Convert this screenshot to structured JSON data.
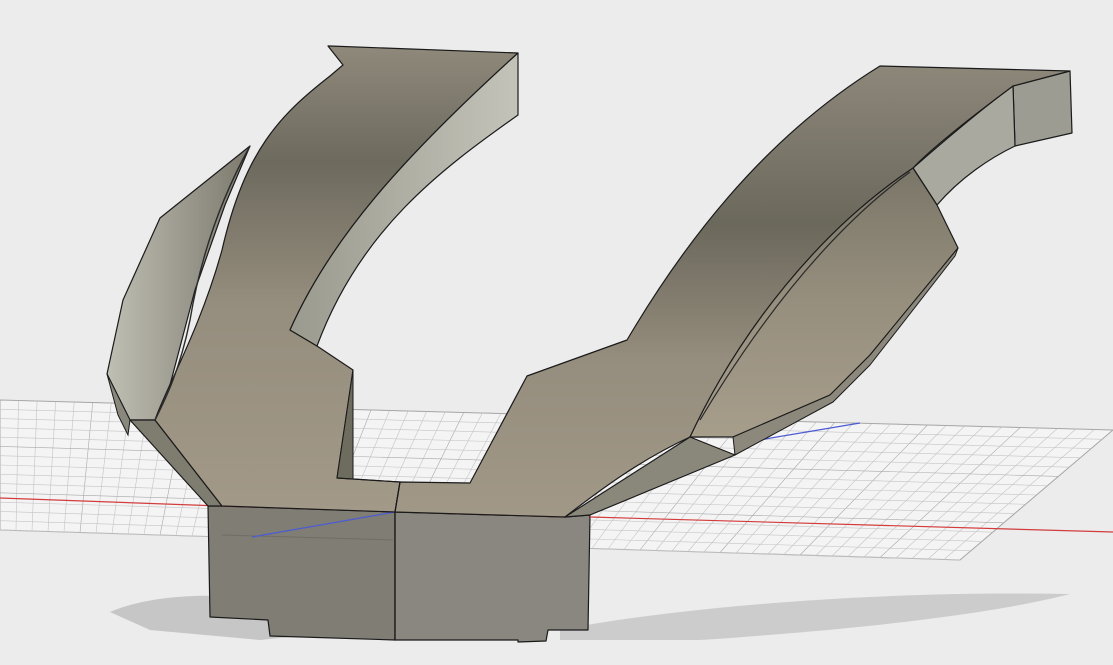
{
  "viewport": {
    "background": "#ececec",
    "grid_line_color": "#c4c4c4",
    "grid_major_color": "#a8a8a8",
    "axis_x_color": "#d23c3c",
    "axis_y_color": "#4b5bd6",
    "model_colors": {
      "front_top": "#9b9282",
      "front_dark": "#6d6a5e",
      "side_light": "#b7b6ab",
      "side_dark": "#7d7a6e",
      "base": "#86847a",
      "edge": "#1a1a1a"
    }
  }
}
